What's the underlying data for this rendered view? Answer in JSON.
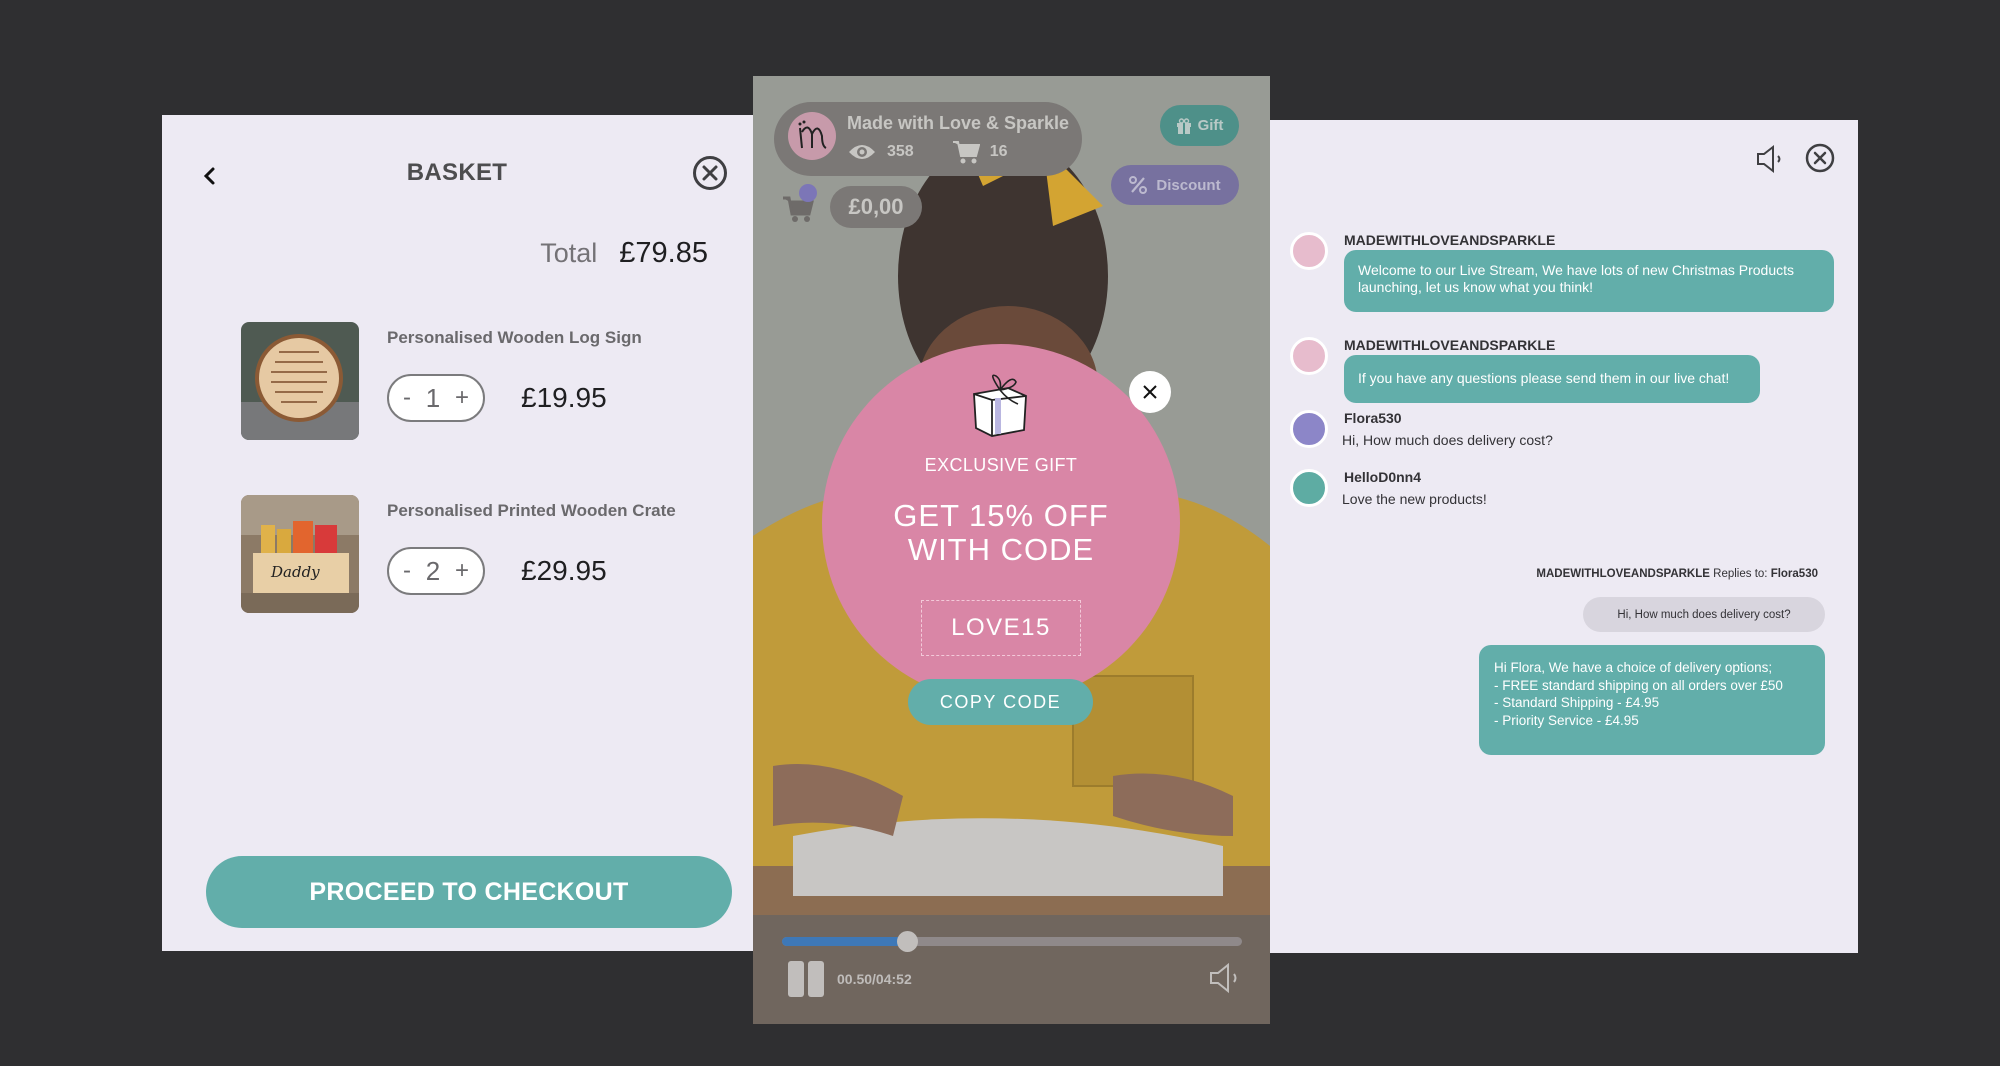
{
  "colors": {
    "teal": "#62aeaa",
    "pink": "#d986a6",
    "purple": "#7c76b7",
    "panel_bg": "#edeaf3",
    "page_bg": "#2f2f31",
    "progress": "#3e78b7"
  },
  "basket": {
    "title": "BASKET",
    "back_icon": "chevron-left-icon",
    "close_icon": "circle-x-icon",
    "total_label": "Total",
    "total_value": "£79.85",
    "items": [
      {
        "name": "Personalised Wooden Log Sign",
        "quantity": "1",
        "price": "£19.95",
        "minus": "-",
        "plus": "+"
      },
      {
        "name": "Personalised Printed Wooden Crate",
        "quantity": "2",
        "price": "£29.95",
        "minus": "-",
        "plus": "+"
      }
    ],
    "checkout_label": "PROCEED TO CHECKOUT"
  },
  "video": {
    "streamer_name": "Made with Love & Sparkle",
    "streamer_initial": "m",
    "viewers": "358",
    "cart_count": "16",
    "cart_total": "£0,00",
    "gift_label": "Gift",
    "discount_label": "Discount",
    "promo": {
      "eyebrow": "EXCLUSIVE GIFT",
      "headline_line1": "GET 15% OFF",
      "headline_line2": "WITH CODE",
      "code": "LOVE15",
      "copy_label": "COPY CODE"
    },
    "player": {
      "time": "00.50/04:52",
      "progress_fraction": 0.272
    }
  },
  "chat": {
    "messages": [
      {
        "author": "MADEWITHLOVEANDSPARKLE",
        "text": "Welcome to our Live Stream, We have lots of new Christmas Products launching, let us know what you think!",
        "type": "brand"
      },
      {
        "author": "MADEWITHLOVEANDSPARKLE",
        "text": "If you have any questions please send them in our live chat!",
        "type": "brand"
      },
      {
        "author": "Flora530",
        "text": "Hi, How much does delivery cost?",
        "type": "user",
        "avatar_color": "#8c86c8"
      },
      {
        "author": "HelloD0nn4",
        "text": "Love the new products!",
        "type": "user",
        "avatar_color": "#5eaca3"
      }
    ],
    "reply": {
      "author": "MADEWITHLOVEANDSPARKLE",
      "replies_to_label": "Replies to:",
      "replies_to_user": "Flora530",
      "quoted_text": "Hi, How much does delivery cost?",
      "text": "Hi Flora, We have a choice of delivery options;\n- FREE standard shipping on all orders over £50\n- Standard Shipping - £4.95\n- Priority Service - £4.95"
    }
  }
}
